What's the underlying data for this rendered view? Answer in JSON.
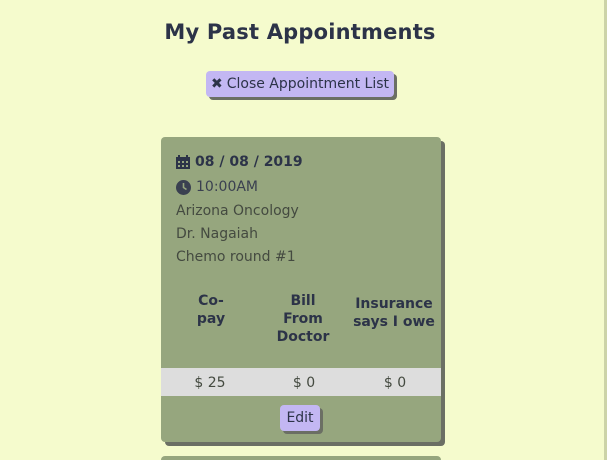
{
  "header": {
    "title": "My Past Appointments"
  },
  "toolbar": {
    "close_icon": "times-icon",
    "close_label": "Close Appointment List"
  },
  "appointment": {
    "date": "08 / 08 / 2019",
    "time": "10:00AM",
    "location": "Arizona Oncology",
    "doctor": "Dr. Nagaiah",
    "notes": "Chemo round #1",
    "columns": {
      "copay": {
        "line1": "Co-",
        "line2": "pay"
      },
      "bill": {
        "line1": "Bill",
        "line2": "From",
        "line3": "Doctor"
      },
      "insurance": {
        "line1": "Insurance",
        "line2": "says I owe"
      }
    },
    "amounts": {
      "copay": "$ 25",
      "bill": "$ 0",
      "insurance": "$ 0"
    },
    "edit_label": "Edit"
  },
  "colors": {
    "background": "#f5fbcd",
    "card": "#96a67e",
    "button": "#c3b7f3",
    "text_dark": "#2c3348",
    "amount_row": "#dddddd"
  }
}
